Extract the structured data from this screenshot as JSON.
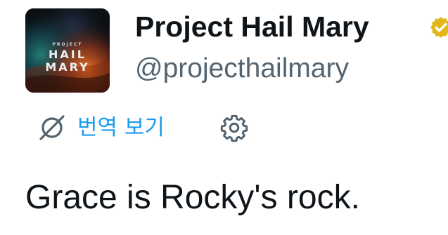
{
  "account": {
    "display_name": "Project Hail Mary",
    "handle": "@projecthailmary",
    "verified": true,
    "avatar": {
      "logo_text": [
        "PROJECT",
        "HAIL",
        "MARY"
      ]
    }
  },
  "translate": {
    "label": "번역 보기",
    "icon": "translate-globe-icon"
  },
  "settings": {
    "icon": "gear-icon"
  },
  "tweet": {
    "text": "Grace is Rocky's rock."
  },
  "colors": {
    "link": "#1d9bf0",
    "secondary_text": "#536471",
    "primary_text": "#0f1419",
    "verified_badge": "#e2b719"
  }
}
